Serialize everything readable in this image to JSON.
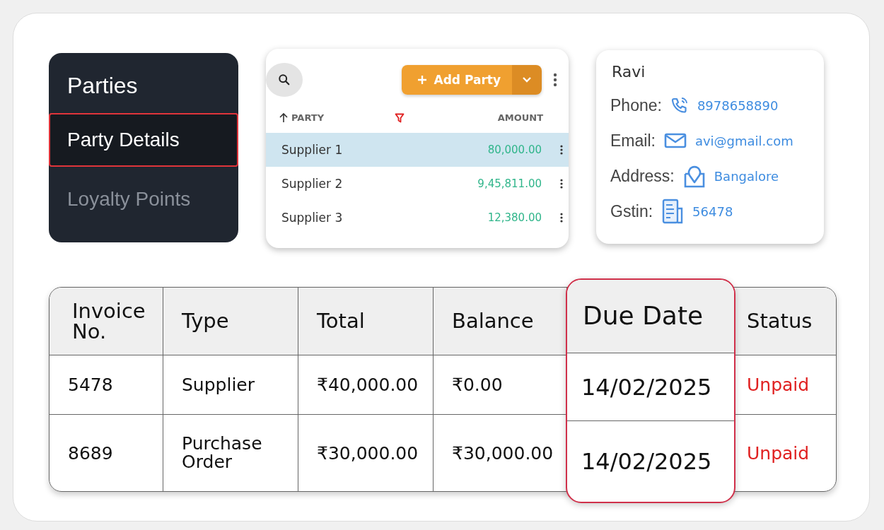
{
  "sidebar": {
    "title": "Parties",
    "items": [
      {
        "label": "Party Details",
        "selected": true
      },
      {
        "label": "Loyalty Points",
        "selected": false
      }
    ]
  },
  "party_list": {
    "add_button": "Add Party",
    "columns": [
      "PARTY",
      "AMOUNT"
    ],
    "rows": [
      {
        "name": "Supplier 1",
        "amount": "80,000.00",
        "selected": true
      },
      {
        "name": "Supplier 2",
        "amount": "9,45,811.00",
        "selected": false
      },
      {
        "name": "Supplier 3",
        "amount": "12,380.00",
        "selected": false
      }
    ]
  },
  "contact": {
    "name": "Ravi",
    "fields": [
      {
        "kind": "phone",
        "label": "Phone:",
        "value": "8978658890"
      },
      {
        "kind": "email",
        "label": "Email:",
        "value": "avi@gmail.com"
      },
      {
        "kind": "address",
        "label": "Address:",
        "value": "Bangalore"
      },
      {
        "kind": "gstin",
        "label": "Gstin:",
        "value": "56478"
      }
    ]
  },
  "invoice_table": {
    "columns": [
      {
        "label": "Invoice No.",
        "highlighted": false
      },
      {
        "label": "Type",
        "highlighted": false
      },
      {
        "label": "Total",
        "highlighted": false
      },
      {
        "label": "Balance",
        "highlighted": false
      },
      {
        "label": "Due Date",
        "highlighted": true
      },
      {
        "label": "Status",
        "highlighted": false
      }
    ],
    "rows": [
      [
        "5478",
        "Supplier",
        "₹40,000.00",
        "₹0.00",
        "14/02/2025",
        "Unpaid"
      ],
      [
        "8689",
        "Purchase Order",
        "₹30,000.00",
        "₹30,000.00",
        "14/02/2025",
        "Unpaid"
      ]
    ]
  }
}
